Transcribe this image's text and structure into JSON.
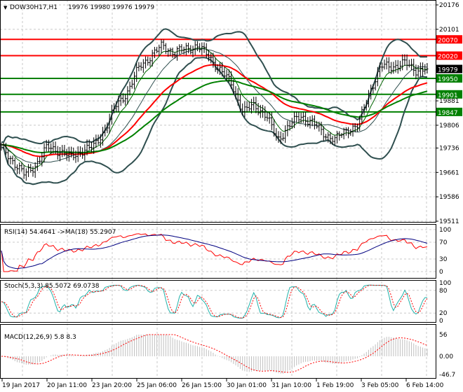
{
  "header": {
    "symbol": "DOW30H17,H1",
    "ohlc": "19976 19980 19976 19979"
  },
  "chart_data": [
    {
      "type": "candlestick",
      "title": "DOW30H17,H1",
      "ylim": [
        19511,
        20176
      ],
      "y_ticks": [
        "20176",
        "20101",
        "19881",
        "19806",
        "19736",
        "19661",
        "19586",
        "19511"
      ],
      "x_ticks": [
        "19 Jan 2017",
        "20 Jan 11:00",
        "23 Jan 20:00",
        "25 Jan 06:00",
        "26 Jan 15:00",
        "30 Jan 01:00",
        "31 Jan 10:00",
        "1 Feb 19:00",
        "3 Feb 05:00",
        "6 Feb 14:00"
      ],
      "close_series": [
        19739,
        19696,
        19653,
        19685,
        19739,
        19728,
        19707,
        19728,
        19739,
        19793,
        19868,
        19911,
        19987,
        20019,
        20051,
        20030,
        20040,
        20051,
        20019,
        19976,
        19933,
        19847,
        19868,
        19836,
        19761,
        19804,
        19836,
        19814,
        19782,
        19761,
        19793,
        19804,
        19911,
        19987,
        19987,
        19997,
        19976,
        19979
      ],
      "current_price": {
        "label": "19979",
        "color": "#000000"
      },
      "levels": [
        {
          "label": "20070",
          "value": 20070,
          "color": "#ff0000"
        },
        {
          "label": "20020",
          "value": 20020,
          "color": "#ff0000"
        },
        {
          "label": "19950",
          "value": 19950,
          "color": "#008000"
        },
        {
          "label": "19901",
          "value": 19901,
          "color": "#008000"
        },
        {
          "label": "19847",
          "value": 19847,
          "color": "#008000"
        }
      ],
      "overlays": [
        "bollinger-bands",
        "moving-averages"
      ]
    },
    {
      "type": "line",
      "title": "RSI(14) 54.4641  ->MA(18) 55.2907",
      "ylim": [
        0,
        100
      ],
      "y_ticks": [
        "100",
        "70",
        "30",
        "0"
      ],
      "series": [
        {
          "color": "#ff0000"
        },
        {
          "color": "#000080"
        }
      ]
    },
    {
      "type": "line",
      "title": "Stoch(5,3,3) 85.5072 69.0738",
      "ylim": [
        0,
        100
      ],
      "y_ticks": [
        "100",
        "80",
        "20",
        "0"
      ],
      "series": [
        {
          "color": "#20b2aa"
        },
        {
          "color": "#ff0000"
        }
      ]
    },
    {
      "type": "bar",
      "title": "MACD(12,26,9) 5.8 8.3",
      "ylim": [
        -46.7,
        56
      ],
      "y_ticks": [
        "56",
        "0.00",
        "-46.7"
      ],
      "series": [
        {
          "color": "#c0c0c0"
        },
        {
          "color": "#ff0000"
        }
      ]
    }
  ]
}
